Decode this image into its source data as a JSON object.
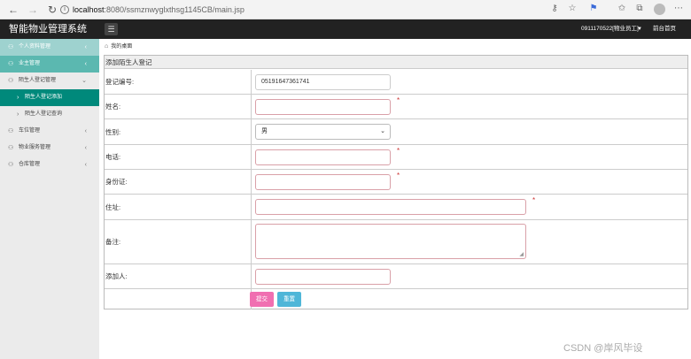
{
  "browser": {
    "url_host": "localhost",
    "url_rest": ":8080/ssmznwyglxthsg1145CB/main.jsp"
  },
  "app": {
    "title": "智能物业管理系统",
    "user": "0911170522[物业员工]",
    "home_link": "前台首页"
  },
  "sidebar": {
    "items": [
      {
        "label": "个人资料管理"
      },
      {
        "label": "业主管理"
      },
      {
        "label": "陌生人登记管理"
      },
      {
        "label": "陌生人登记添加"
      },
      {
        "label": "陌生人登记查询"
      },
      {
        "label": "车位管理"
      },
      {
        "label": "物业服务管理"
      },
      {
        "label": "仓库管理"
      }
    ]
  },
  "breadcrumb": "我的桌面",
  "form": {
    "title": "添加陌生人登记",
    "reg_no_label": "登记编号:",
    "reg_no_value": "05191647361741",
    "name_label": "姓名:",
    "gender_label": "性别:",
    "gender_value": "男",
    "phone_label": "电话:",
    "idcard_label": "身份证:",
    "address_label": "住址:",
    "remark_label": "备注:",
    "adder_label": "添加人:",
    "required_mark": "*",
    "submit": "提交",
    "reset": "重置"
  },
  "watermark": "CSDN @岸风毕设"
}
